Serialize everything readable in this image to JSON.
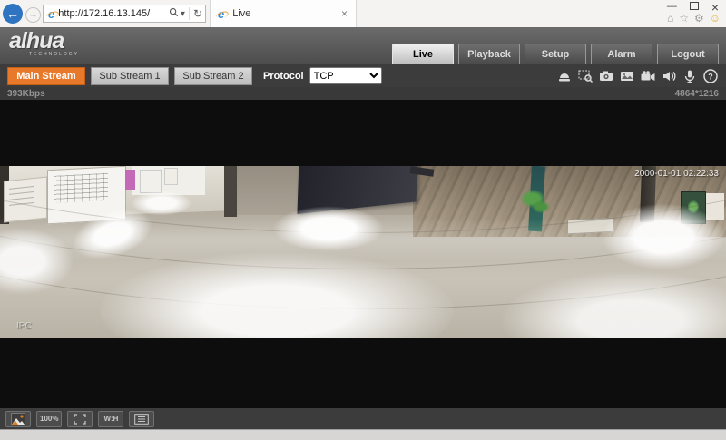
{
  "browser": {
    "url": "http://172.16.13.145/",
    "tab": {
      "title": "Live"
    }
  },
  "icons": {
    "back": "←",
    "forward": "→",
    "refresh": "↻",
    "dropdown": "▾",
    "home": "⌂",
    "favorites": "☆",
    "settings": "⚙",
    "feedback": "☺",
    "minimize": "—",
    "close": "×",
    "tab_close": "×"
  },
  "header": {
    "logo_text": "alhua",
    "logo_sub": "TECHNOLOGY",
    "nav": [
      {
        "label": "Live",
        "active": true
      },
      {
        "label": "Playback",
        "active": false
      },
      {
        "label": "Setup",
        "active": false
      },
      {
        "label": "Alarm",
        "active": false
      },
      {
        "label": "Logout",
        "active": false
      }
    ]
  },
  "stream_bar": {
    "buttons": [
      {
        "label": "Main Stream",
        "active": true
      },
      {
        "label": "Sub Stream 1",
        "active": false
      },
      {
        "label": "Sub Stream 2",
        "active": false
      }
    ],
    "protocol_label": "Protocol",
    "protocol_value": "TCP",
    "icon_names": [
      "relay-out",
      "digital-zoom",
      "snapshot",
      "triple-snapshot",
      "record",
      "audio",
      "talk",
      "help"
    ]
  },
  "video": {
    "bitrate": "393Kbps",
    "resolution": "4864*1216",
    "timestamp": "2000-01-01 02:22:33",
    "channel_label": "IPC"
  },
  "bottom_bar": {
    "zoom_label": "100%",
    "aspect_label": "W:H",
    "icon_names": [
      "image-adjust",
      "original-size",
      "full-screen",
      "aspect-ratio",
      "fluency"
    ]
  },
  "colors": {
    "accent_orange": "#e8782a",
    "header_gray": "#5a5a5a",
    "toolbar_gray": "#3c3c3c"
  }
}
